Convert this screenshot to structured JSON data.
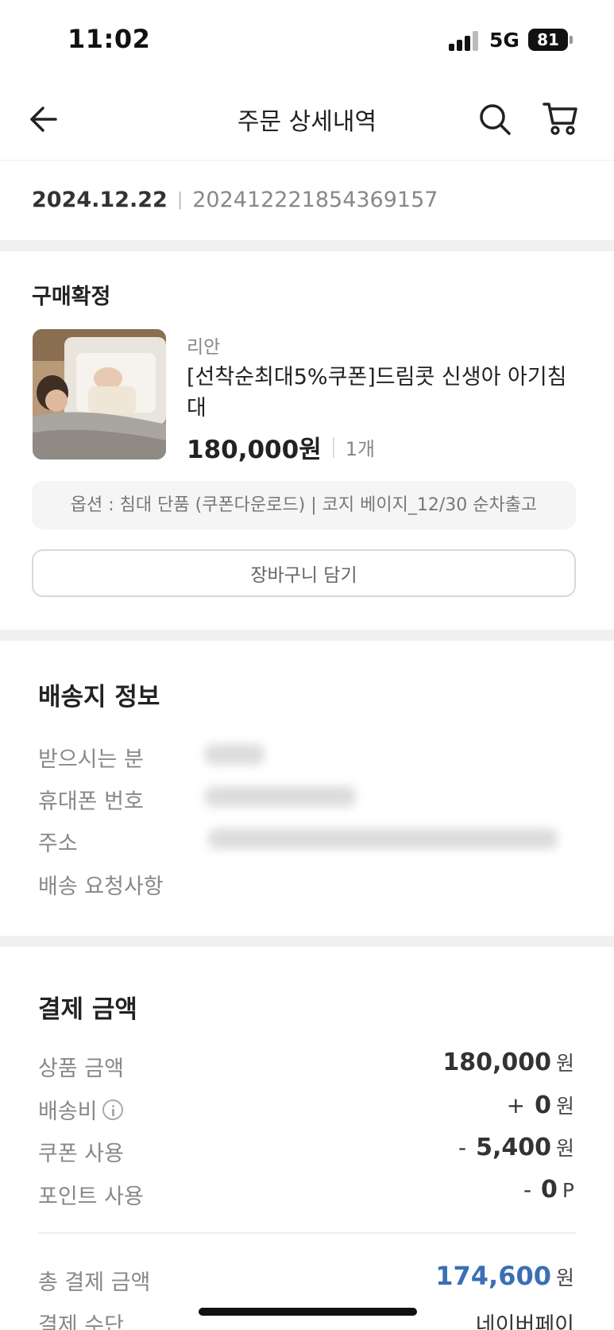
{
  "status_bar": {
    "time": "11:02",
    "network": "5G",
    "battery": "81"
  },
  "header": {
    "title": "주문 상세내역"
  },
  "order": {
    "date": "2024.12.22",
    "number": "2024122218543691​57"
  },
  "product": {
    "status": "구매확정",
    "brand": "리안",
    "name": "[선착순최대5%쿠폰]드림콧 신생아 아기침대",
    "price": "180,000원",
    "quantity": "1개",
    "option": "옵션 : 침대 단품 (쿠폰다운로드) | 코지 베이지_12/30 순차출고",
    "add_to_cart_label": "장바구니 담기"
  },
  "shipping": {
    "title": "배송지 정보",
    "labels": [
      "받으시는 분",
      "휴대폰 번호",
      "주소",
      "배송 요청사항"
    ]
  },
  "payment": {
    "title": "결제 금액",
    "rows": [
      {
        "label": "상품 금액",
        "prefix": "",
        "value": "180,000",
        "unit": "원"
      },
      {
        "label": "배송비",
        "prefix": "+",
        "value": "0",
        "unit": "원"
      },
      {
        "label": "쿠폰 사용",
        "prefix": "-",
        "value": "5,400",
        "unit": "원"
      },
      {
        "label": "포인트 사용",
        "prefix": "-",
        "value": "0",
        "unit": "P"
      }
    ],
    "total_label": "총 결제 금액",
    "total_value": "174,600",
    "total_unit": "원",
    "method_label": "결제 수단",
    "method_value": "네이버페이"
  },
  "colors": {
    "accent": "#3a6fb3",
    "section_gap": "#f0f0f0"
  },
  "icons": [
    "back-arrow-icon",
    "search-icon",
    "cart-icon",
    "info-icon"
  ]
}
